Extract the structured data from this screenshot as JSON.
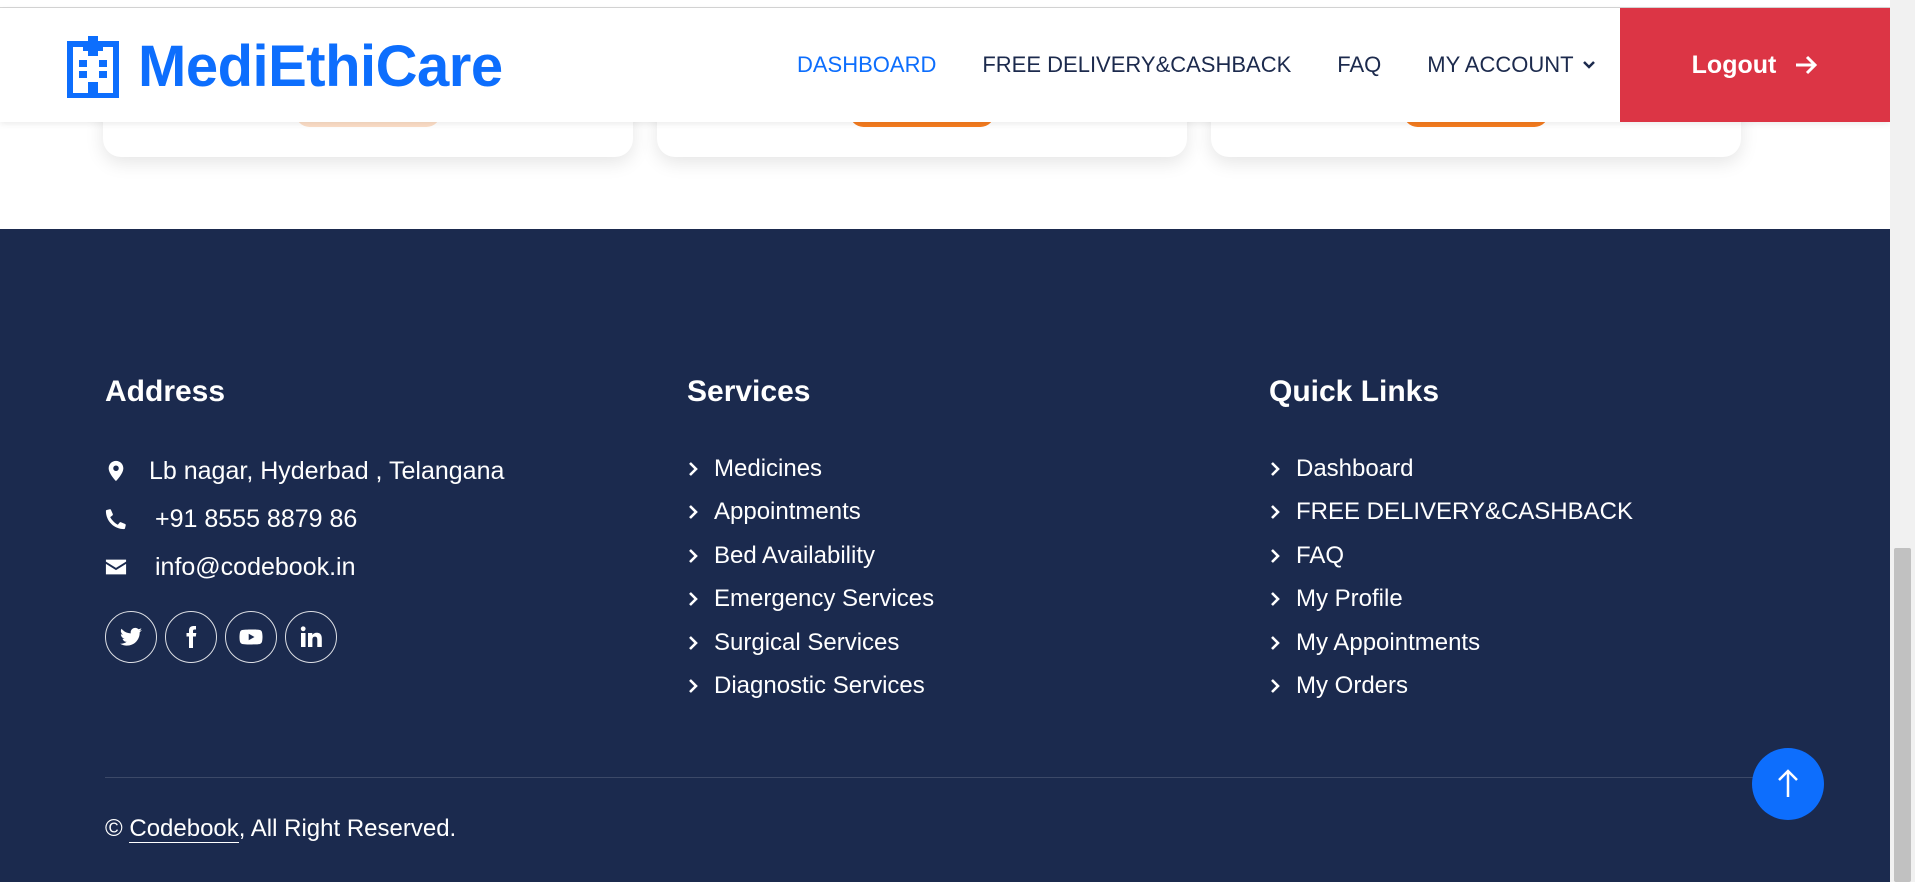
{
  "brand": {
    "name": "MediEthiCare"
  },
  "nav": {
    "items": [
      "DASHBOARD",
      "FREE DELIVERY&CASHBACK",
      "FAQ",
      "MY ACCOUNT"
    ],
    "logout_label": "Logout"
  },
  "footer": {
    "address": {
      "title": "Address",
      "location": "Lb nagar, Hyderbad , Telangana",
      "phone": "+91 8555 8879 86",
      "email": "info@codebook.in"
    },
    "services": {
      "title": "Services",
      "items": [
        "Medicines",
        "Appointments",
        "Bed Availability",
        "Emergency Services",
        "Surgical Services",
        "Diagnostic Services"
      ]
    },
    "quick_links": {
      "title": "Quick Links",
      "items": [
        "Dashboard",
        "FREE DELIVERY&CASHBACK",
        "FAQ",
        "My Profile",
        "My Appointments",
        "My Orders"
      ]
    },
    "copyright": {
      "prefix": "© ",
      "link": "Codebook",
      "suffix": ", All Right Reserved."
    }
  },
  "icons": {
    "brand": "hospital-icon",
    "location": "map-marker-icon",
    "phone": "phone-icon",
    "email": "envelope-icon",
    "socials": [
      "twitter-icon",
      "facebook-icon",
      "youtube-icon",
      "linkedin-icon"
    ],
    "logout": "arrow-right-icon",
    "back_to_top": "arrow-up-icon"
  },
  "colors": {
    "primary": "#0d6efd",
    "logout": "#dc3545",
    "footer_bg": "#1b2a4e",
    "accent_orange": "#f57c1f"
  }
}
